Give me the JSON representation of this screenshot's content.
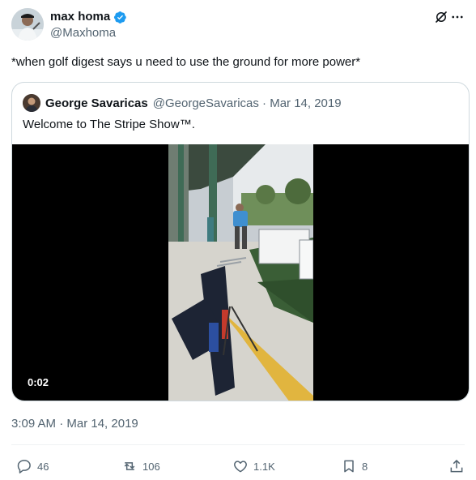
{
  "author": {
    "display_name": "max homa",
    "handle": "@Maxhoma",
    "verified": true
  },
  "tweet": {
    "text": "*when golf digest says u need to use the ground for more power*",
    "timestamp": "3:09 AM · Mar 14, 2019"
  },
  "quoted_tweet": {
    "display_name": "George Savaricas",
    "meta": "@GeorgeSavaricas · Mar 14, 2019",
    "text": "Welcome to The Stripe Show™.",
    "video_duration": "0:02"
  },
  "actions": {
    "replies": "46",
    "reposts": "106",
    "likes": "1.1K",
    "bookmarks": "8"
  },
  "colors": {
    "verified_blue": "#1d9bf0",
    "secondary_text": "#536471",
    "border": "#cfd9de"
  },
  "icons": [
    "grok-icon",
    "more-icon",
    "verified-badge-icon",
    "reply-icon",
    "repost-icon",
    "like-icon",
    "bookmark-icon",
    "share-icon"
  ]
}
